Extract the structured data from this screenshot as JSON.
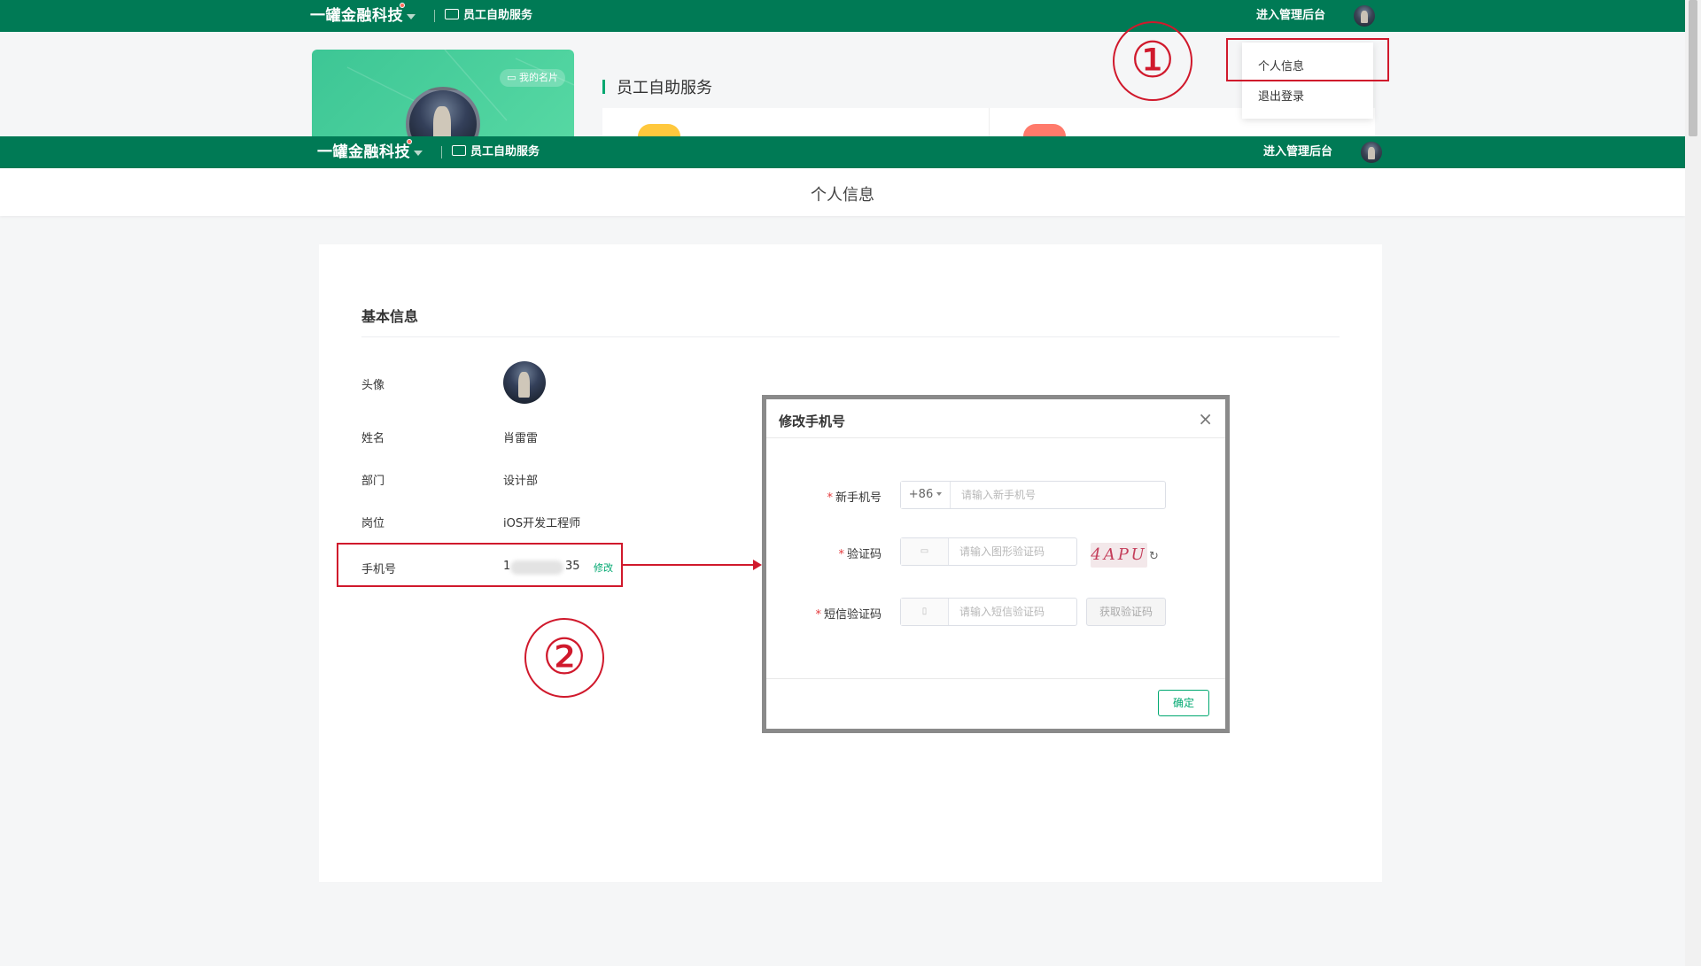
{
  "brand": "一罐金融科技",
  "service_nav": "员工自助服务",
  "admin_link": "进入管理后台",
  "my_card_label": "我的名片",
  "section_title": "员工自助服务",
  "dropdown": {
    "items": [
      "个人信息",
      "退出登录"
    ]
  },
  "annotations": {
    "one": "①",
    "two": "②"
  },
  "subheader_title": "个人信息",
  "basic_info": {
    "title": "基本信息",
    "rows": [
      {
        "label": "头像",
        "value": ""
      },
      {
        "label": "姓名",
        "value": "肖雷雷"
      },
      {
        "label": "部门",
        "value": "设计部"
      },
      {
        "label": "岗位",
        "value": "iOS开发工程师"
      }
    ],
    "phone": {
      "label": "手机号",
      "value_start": "1",
      "value_end": "35",
      "edit_link": "修改"
    }
  },
  "modal": {
    "title": "修改手机号",
    "close": "×",
    "new_phone": {
      "label": "新手机号",
      "prefix": "+86",
      "placeholder": "请输入新手机号"
    },
    "captcha": {
      "label": "验证码",
      "placeholder": "请输入图形验证码",
      "image_text": "4APU"
    },
    "sms": {
      "label": "短信验证码",
      "placeholder": "请输入短信验证码",
      "button": "获取验证码"
    },
    "confirm": "确定"
  },
  "colors": {
    "brand_green": "#007a55",
    "accent_green": "#00a870",
    "annotation_red": "#d0192c"
  }
}
